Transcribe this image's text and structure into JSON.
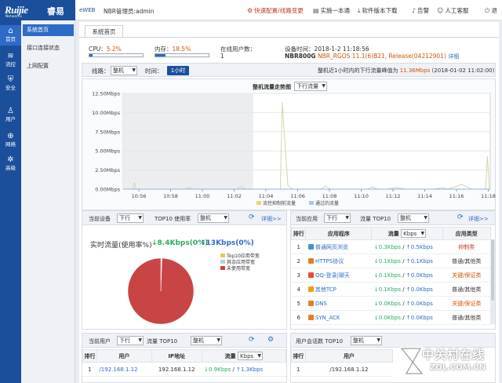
{
  "brand": {
    "logo_text": "Ruijie",
    "logo_sub": "Networks",
    "logo_cn": "睿易",
    "eweb": "eWEB",
    "user_label": "NBR管理员:admin"
  },
  "toplinks": {
    "quick": "快速配置/线路变更",
    "pair": "实施一本通",
    "version": "软件版本下载",
    "alarm": "告警",
    "manual": "人工客服",
    "exit": "退"
  },
  "sidebar": [
    {
      "label": "首页",
      "icon": "home-icon"
    },
    {
      "label": "流控",
      "icon": "flow-icon"
    },
    {
      "label": "安全",
      "icon": "shield-icon"
    },
    {
      "label": "用户",
      "icon": "user-icon"
    },
    {
      "label": "网络",
      "icon": "globe-icon"
    },
    {
      "label": "高级",
      "icon": "gear-icon"
    }
  ],
  "submenu": [
    "系统首页",
    "接口连接状态",
    "上网配置"
  ],
  "tab": "系统首页",
  "status": {
    "cpu_label": "CPU：",
    "cpu_value": "5.2%",
    "cpu_fraction": 0.052,
    "mem_label": "内存：",
    "mem_value": "18.5%",
    "mem_fraction": 0.185,
    "online_label": "在线用户数：",
    "online_value": "1",
    "time_label": "设备时间：",
    "time_value": "2018-1-2 11:18:56",
    "model": "NBR800G",
    "firmware": "NBR_RGOS 11.1(6)B21, Release(04212901)",
    "detail": "详细"
  },
  "controls": {
    "line_label": "线路：",
    "line_value": "整机",
    "time_label": "时间：",
    "time_value": "1小时",
    "peak_text": "整机近1小时内的下行流量峰值为",
    "peak_value": "11.36Mbps",
    "peak_time": "(2018-01-02 11:02:00)"
  },
  "chart_title": "整机流量走势图",
  "chart_select": "下行流量",
  "chart_data": {
    "type": "line",
    "title": "整机流量走势图",
    "x": [
      "10:56",
      "10:58",
      "11:00",
      "11:02",
      "11:04",
      "11:06",
      "11:08",
      "11:10",
      "11:12",
      "11:14",
      "11:16",
      "11:18"
    ],
    "y_ticks": [
      "0.00Mbps",
      "2.50Mbps",
      "5.00Mbps",
      "7.50Mbps",
      "10.00Mbps",
      "12.50Mbps"
    ],
    "ylim": [
      0,
      12.5
    ],
    "legend": [
      "流控抑制前流量",
      "通过的流量"
    ],
    "series": [
      {
        "name": "流控抑制前流量",
        "points": [
          [
            0,
            0
          ],
          [
            2,
            0
          ],
          [
            2.4,
            0.9
          ],
          [
            2.7,
            0
          ],
          [
            4,
            0
          ],
          [
            5,
            0
          ],
          [
            6,
            0
          ],
          [
            7,
            0
          ],
          [
            8,
            0
          ],
          [
            9,
            0
          ],
          [
            10,
            0
          ],
          [
            11,
            0
          ],
          [
            12,
            0
          ],
          [
            13,
            0
          ],
          [
            14,
            0.2
          ],
          [
            15,
            0
          ],
          [
            16,
            0
          ],
          [
            17,
            0
          ],
          [
            18,
            0
          ],
          [
            19,
            0
          ],
          [
            20,
            0
          ],
          [
            21,
            0
          ],
          [
            22,
            0
          ],
          [
            23,
            0
          ],
          [
            24,
            0
          ],
          [
            25,
            0.3
          ],
          [
            26,
            0
          ],
          [
            28,
            0
          ],
          [
            30,
            0
          ],
          [
            32,
            0
          ],
          [
            33.4,
            0
          ],
          [
            33.8,
            11.36
          ],
          [
            34.5,
            5
          ],
          [
            35,
            0.5
          ],
          [
            36,
            0
          ],
          [
            38,
            0
          ],
          [
            40,
            0
          ],
          [
            42,
            0
          ],
          [
            43,
            0.4
          ],
          [
            44,
            0
          ],
          [
            46,
            0
          ],
          [
            48,
            0
          ],
          [
            50,
            0
          ],
          [
            52,
            0
          ],
          [
            53,
            0.3
          ],
          [
            54,
            0
          ],
          [
            56,
            0
          ],
          [
            58,
            0.2
          ],
          [
            60,
            0
          ],
          [
            62,
            0
          ],
          [
            64,
            0
          ],
          [
            66,
            0
          ],
          [
            68,
            0.2
          ],
          [
            69,
            0
          ],
          [
            72,
            0.6
          ],
          [
            74,
            0
          ],
          [
            77,
            0
          ],
          [
            77.4,
            4.3
          ],
          [
            77.8,
            0
          ],
          [
            78,
            0
          ]
        ]
      },
      {
        "name": "通过的流量",
        "points": [
          [
            0,
            0
          ],
          [
            78,
            0
          ]
        ]
      }
    ]
  },
  "device_panel": {
    "label": "当前设备",
    "sort": "下行",
    "top_label": "TOP10 使用率",
    "scope": "整机",
    "more": "详细>>",
    "title": "实时流量(使用率%)",
    "down": "↓8.4Kbps(0%)",
    "up": "↑13Kbps(0%)",
    "legend": [
      {
        "label": "Top10应用带宽",
        "color": "#e8c75a"
      },
      {
        "label": "其余应用带宽",
        "color": "#b7cfe0"
      },
      {
        "label": "未使用带宽",
        "color": "#c94444"
      }
    ],
    "pie": [
      {
        "label": "Top10应用带宽",
        "value": 0.3
      },
      {
        "label": "其余应用带宽",
        "value": 0.3
      },
      {
        "label": "未使用带宽",
        "value": 99.4
      }
    ]
  },
  "app_panel": {
    "label": "当前应用",
    "sort": "下行",
    "top_label": "流量 TOP10",
    "scope": "整机",
    "more": "详细>>",
    "cols": [
      "排行",
      "应用程序",
      "流量",
      "应用类型"
    ],
    "unit": "Kbps",
    "rows": [
      {
        "rank": "1",
        "name": "普通网页浏览",
        "color": "#4a90d9",
        "down": "↓0.3Kbps",
        "up": "↑0.5Kbps",
        "type": "抑制类",
        "tcls": "r"
      },
      {
        "rank": "2",
        "name": "HTTPS协议",
        "color": "#e67e22",
        "down": "↓0.1Kbps",
        "up": "↑0.1Kbps",
        "type": "普通/其他类",
        "tcls": ""
      },
      {
        "rank": "3",
        "name": "QQ-登录|聊天",
        "color": "#e74c3c",
        "down": "↓0.1Kbps",
        "up": "↑0.0Kbps",
        "type": "关键/保证类",
        "tcls": "o"
      },
      {
        "rank": "4",
        "name": "其他TCP",
        "color": "#f39c12",
        "down": "↓0.1Kbps",
        "up": "↑0.0Kbps",
        "type": "普通/其他类",
        "tcls": ""
      },
      {
        "rank": "5",
        "name": "DNS",
        "color": "#e67e22",
        "down": "↓0.0Kbps",
        "up": "↑0.0Kbps",
        "type": "关键/保证类",
        "tcls": "o"
      },
      {
        "rank": "6",
        "name": "SYN_ACK",
        "color": "#e67e22",
        "down": "↓0.0Kbps",
        "up": "↑0.0Kbps",
        "type": "普通/其他类",
        "tcls": ""
      }
    ]
  },
  "user_panel": {
    "label": "当前用户",
    "sort": "下行",
    "top_label": "流量 TOP10",
    "scope": "整机",
    "cols": [
      "排行",
      "用户",
      "IP地址",
      "流量"
    ],
    "unit": "Kbps",
    "rows": [
      {
        "rank": "1",
        "user": "/192.168.1.12",
        "ip": "192.168.1.12",
        "down": "↓0.9Kbps",
        "up": "↑1.3Kbps"
      }
    ]
  },
  "session_panel": {
    "label": "用户会话数 TOP10",
    "scope": "整机",
    "cols": [
      "排行",
      "用户"
    ],
    "rows": [
      {
        "rank": "1",
        "user": "/192.168.1.12"
      }
    ]
  },
  "watermark": {
    "text": "中关村在线",
    "url": "ZOL.COM.CN"
  }
}
